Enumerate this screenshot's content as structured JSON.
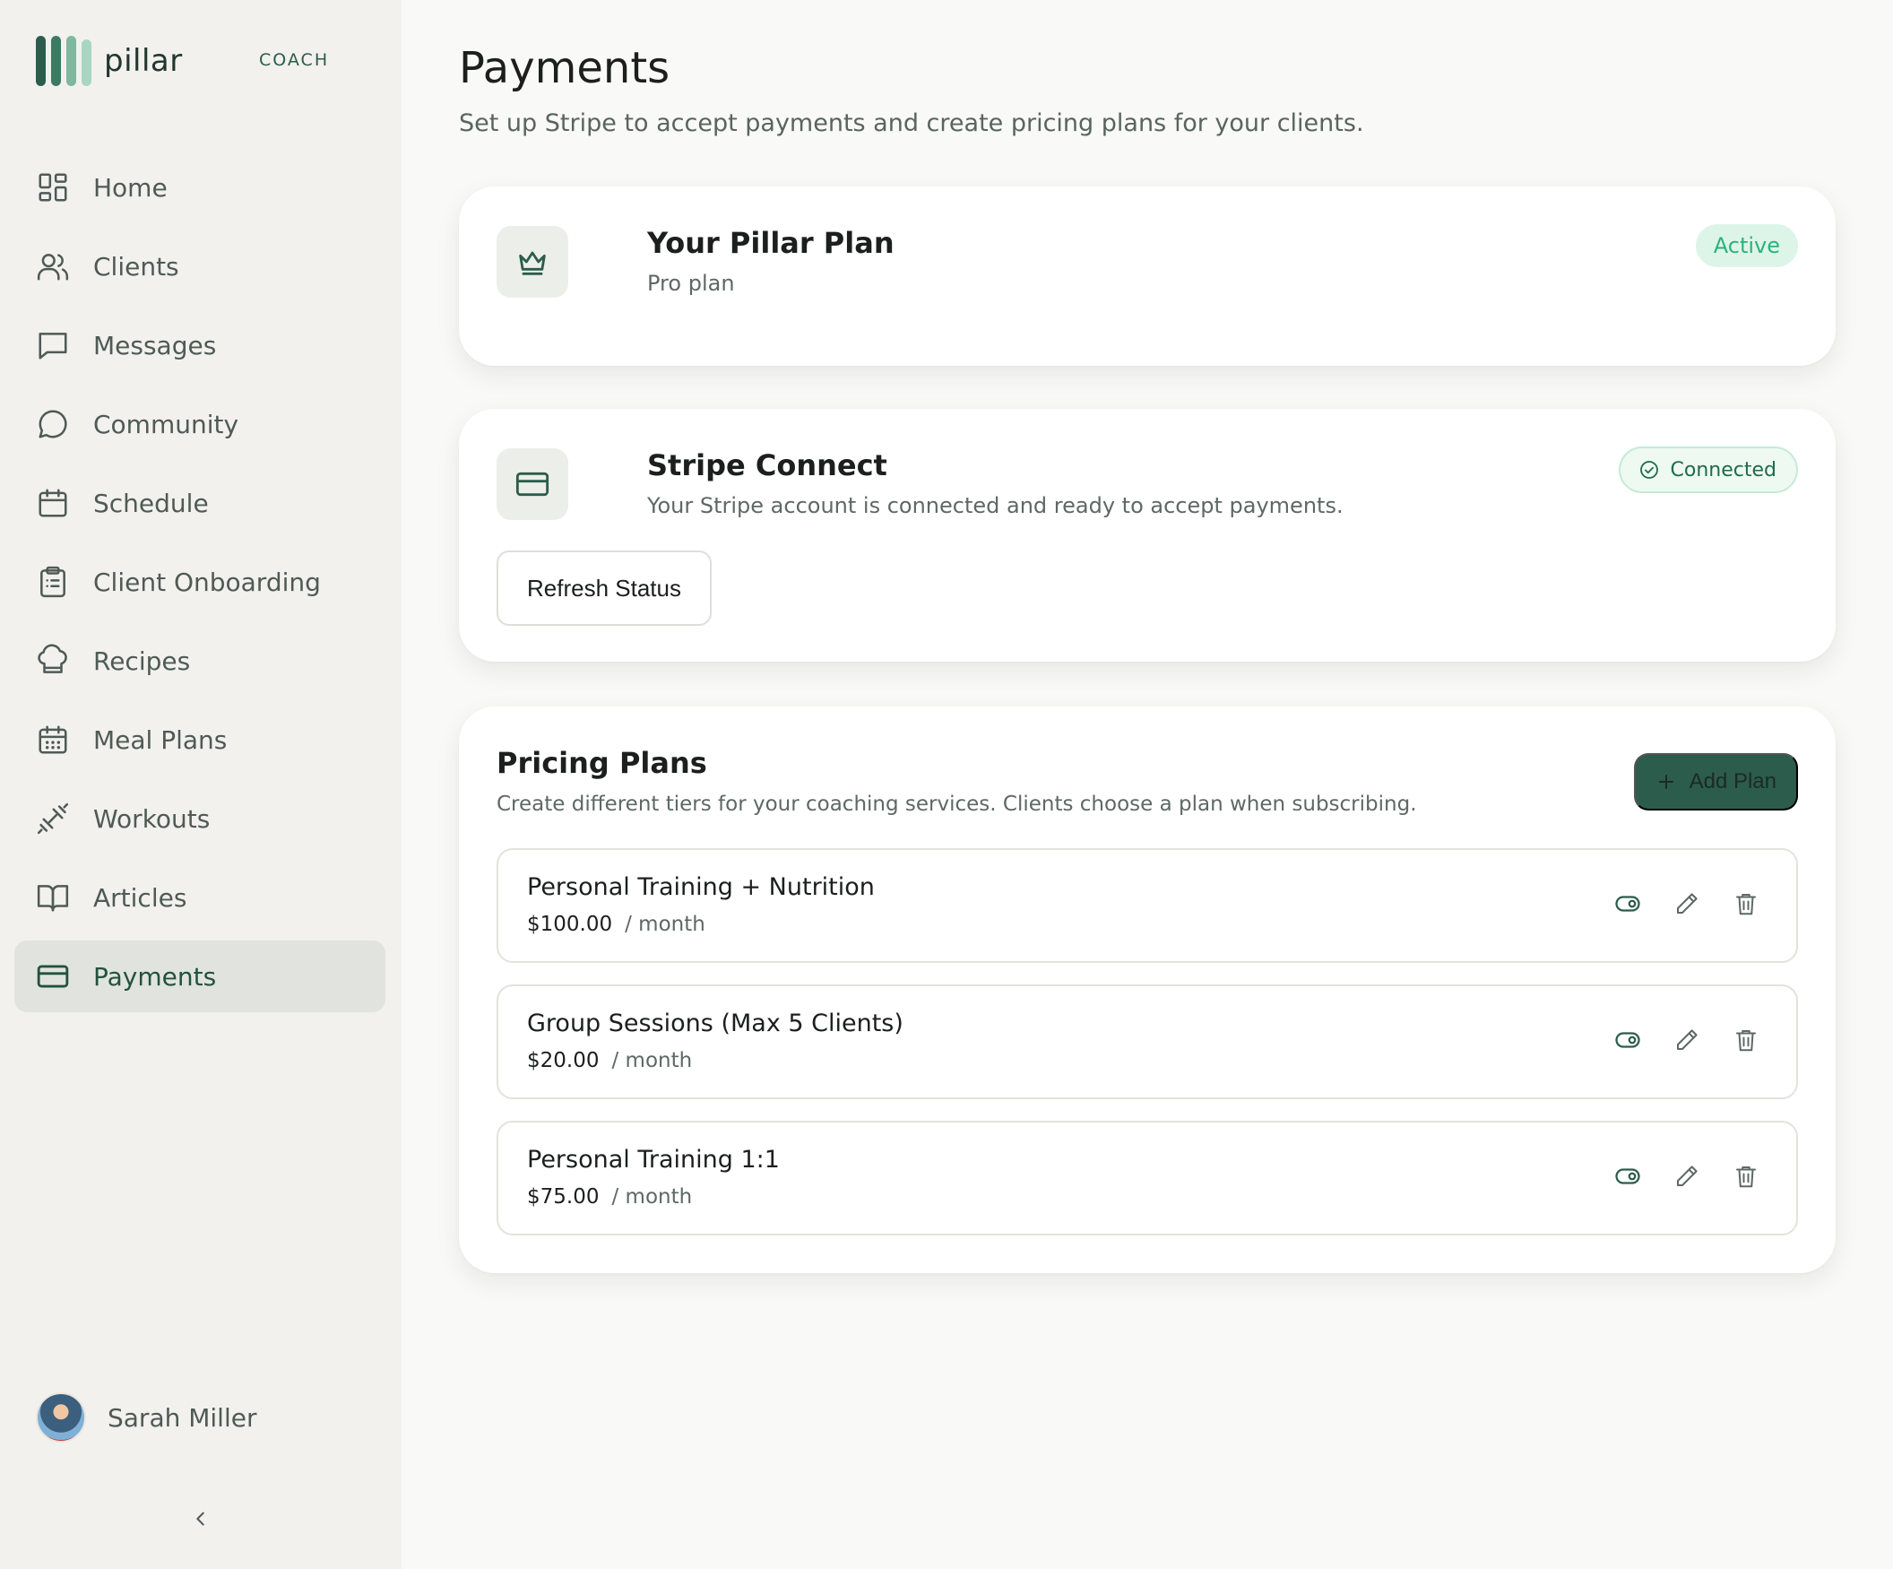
{
  "brand": {
    "name": "pillar",
    "tag": "COACH",
    "colors": [
      "#2c5c4c",
      "#3e7a63",
      "#7fb79f",
      "#a9d6c2"
    ]
  },
  "nav": [
    {
      "label": "Home",
      "icon": "home-grid-icon",
      "active": false
    },
    {
      "label": "Clients",
      "icon": "users-icon",
      "active": false
    },
    {
      "label": "Messages",
      "icon": "message-square-icon",
      "active": false
    },
    {
      "label": "Community",
      "icon": "chat-bubble-icon",
      "active": false
    },
    {
      "label": "Schedule",
      "icon": "calendar-icon",
      "active": false
    },
    {
      "label": "Client Onboarding",
      "icon": "clipboard-icon",
      "active": false
    },
    {
      "label": "Recipes",
      "icon": "chef-hat-icon",
      "active": false
    },
    {
      "label": "Meal Plans",
      "icon": "calendar-grid-icon",
      "active": false
    },
    {
      "label": "Workouts",
      "icon": "dumbbell-icon",
      "active": false
    },
    {
      "label": "Articles",
      "icon": "book-open-icon",
      "active": false
    },
    {
      "label": "Payments",
      "icon": "credit-card-icon",
      "active": true
    }
  ],
  "profile": {
    "name": "Sarah Miller"
  },
  "page": {
    "title": "Payments",
    "subtitle": "Set up Stripe to accept payments and create pricing plans for your clients."
  },
  "pillar_plan": {
    "title": "Your Pillar Plan",
    "plan": "Pro plan",
    "status": "Active",
    "icon": "crown-icon"
  },
  "stripe": {
    "title": "Stripe Connect",
    "description": "Your Stripe account is connected and ready to accept payments.",
    "status": "Connected",
    "refresh_label": "Refresh Status",
    "icon": "credit-card-icon"
  },
  "pricing": {
    "title": "Pricing Plans",
    "description": "Create different tiers for your coaching services. Clients choose a plan when subscribing.",
    "add_label": "Add Plan",
    "plans": [
      {
        "name": "Personal Training + Nutrition",
        "price": "$100.00",
        "period": "/ month"
      },
      {
        "name": "Group Sessions (Max 5 Clients)",
        "price": "$20.00",
        "period": "/ month"
      },
      {
        "name": "Personal Training 1:1",
        "price": "$75.00",
        "period": "/ month"
      }
    ]
  },
  "colors": {
    "accent": "#2c5c4c",
    "active_badge_bg": "#ddf5e9",
    "active_badge_text": "#2bb37a",
    "connected_text": "#1f6b49"
  }
}
